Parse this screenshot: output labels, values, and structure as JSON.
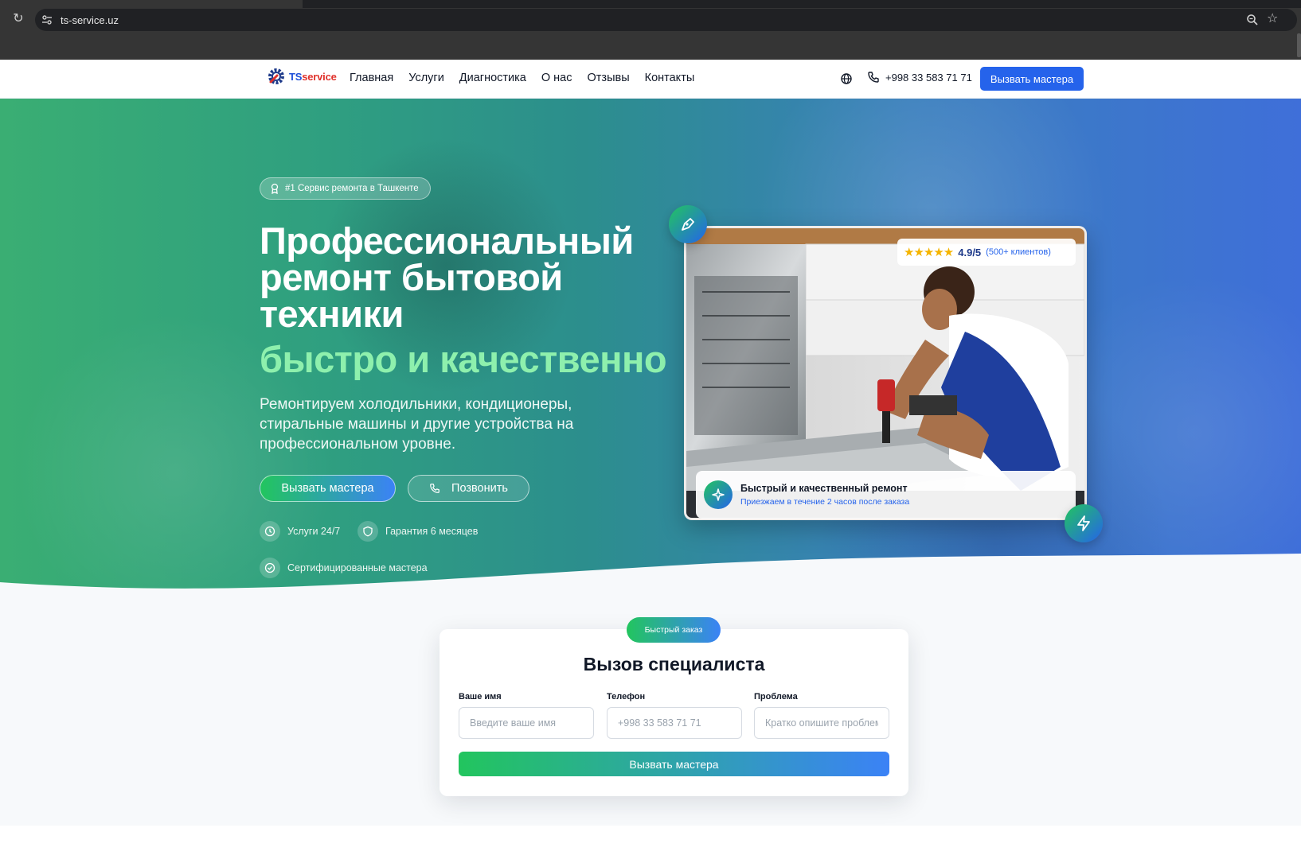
{
  "browser": {
    "url": "ts-service.uz"
  },
  "header": {
    "logo_ts": "TS",
    "logo_service": "service",
    "nav": [
      {
        "label": "Главная"
      },
      {
        "label": "Услуги"
      },
      {
        "label": "Диагностика"
      },
      {
        "label": "О нас"
      },
      {
        "label": "Отзывы"
      },
      {
        "label": "Контакты"
      }
    ],
    "phone": "+998 33 583 71 71",
    "cta_label": "Вызвать мастера"
  },
  "hero": {
    "badge": "#1 Сервис ремонта в Ташкенте",
    "title_lines": [
      "Профессиональный",
      "ремонт бытовой",
      "техники"
    ],
    "title_accent": "быстро и качественно",
    "description": "Ремонтируем холодильники, кондиционеры, стиральные машины и другие устройства на профессиональном уровне.",
    "primary_button": "Вызвать мастера",
    "secondary_button": "Позвонить",
    "features": [
      {
        "label": "Услуги 24/7",
        "icon": "clock-icon"
      },
      {
        "label": "Гарантия 6 месяцев",
        "icon": "shield-icon"
      },
      {
        "label": "Сертифицированные мастера",
        "icon": "check-circle-icon"
      }
    ],
    "rating": {
      "stars": 5,
      "value": "4.9/5",
      "count": "(500+ клиентов)"
    },
    "info_card": {
      "title": "Быстрый и качественный ремонт",
      "subtitle": "Приезжаем в течение 2 часов после заказа"
    }
  },
  "order": {
    "tag": "Быстрый заказ",
    "title": "Вызов специалиста",
    "fields": [
      {
        "label": "Ваше имя",
        "placeholder": "Введите ваше имя"
      },
      {
        "label": "Телефон",
        "placeholder": "+998 33 583 71 71"
      },
      {
        "label": "Проблема",
        "placeholder": "Кратко опишите проблему"
      }
    ],
    "submit": "Вызвать мастера"
  },
  "colors": {
    "brand_blue": "#2563eb",
    "brand_green": "#22c55e",
    "accent_text": "#8ef0ad",
    "star": "#f5b400"
  }
}
